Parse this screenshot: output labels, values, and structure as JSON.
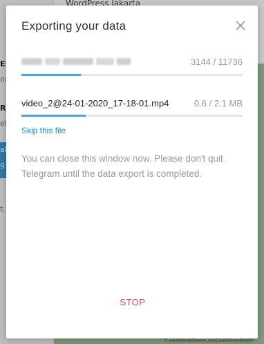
{
  "background": {
    "top_title": "WordPress Jakarta",
    "left_fragments": [
      "ES",
      "oa",
      "R_",
      "el",
      "al",
      "g",
      "t."
    ],
    "right_fragment": "/",
    "service_message": "Jamie Aditya joined th"
  },
  "dialog": {
    "title": "Exporting your data",
    "close_icon": "close-icon",
    "overall_count": "3144 / 11736",
    "overall_progress": 0.27,
    "file_name": "video_2@24-01-2020_17-18-01.mp4",
    "file_size": "0.6 / 2.1 MB",
    "file_progress": 0.29,
    "skip_label": "Skip this file",
    "about": "You can close this window now. Please don't quit Telegram until the data export is completed.",
    "stop_label": "STOP"
  },
  "colors": {
    "accent": "#4ba3e3",
    "link": "#168acd",
    "stop": "#d14e4e",
    "muted_text": "#999999"
  }
}
